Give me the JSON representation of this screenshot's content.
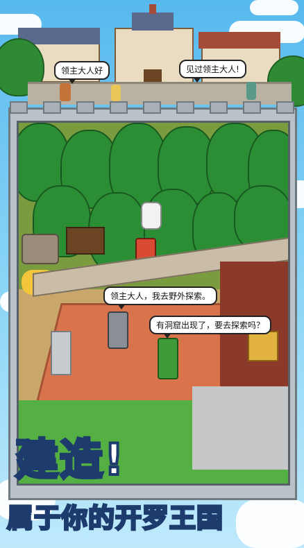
{
  "scene": {
    "top_bubbles": [
      {
        "text": "领主大人好"
      },
      {
        "text": "见过领主大人!"
      }
    ],
    "game_bubbles": [
      {
        "text": "领主大人，我去野外探索。"
      },
      {
        "text": "有洞窟出现了，要去探索吗？"
      }
    ]
  },
  "title": {
    "line1": "建造!",
    "line2_prefix": "属于你的",
    "line2_highlight": "开罗王国"
  },
  "colors": {
    "title_fill": "#ffffff",
    "title_stroke": "#1d3b6d",
    "highlight": "#ffd94a",
    "sky": "#58b9ee"
  }
}
